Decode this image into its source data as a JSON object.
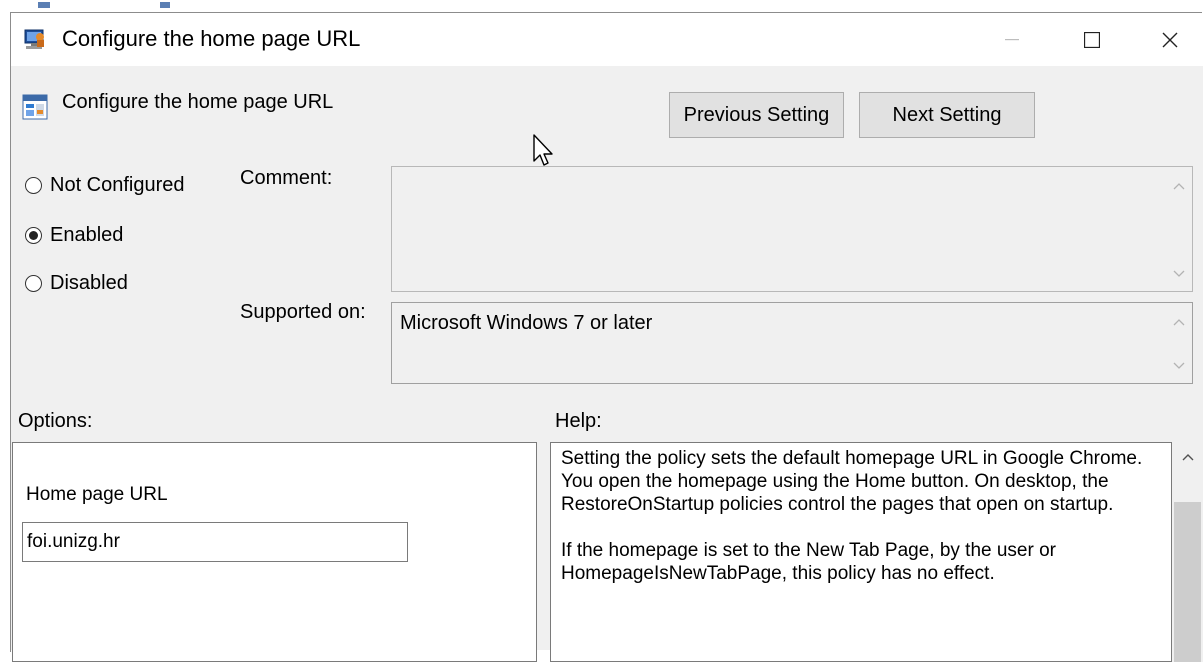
{
  "window": {
    "title": "Configure the home page URL",
    "controls": {
      "minimize": "—",
      "maximize": "☐",
      "close": "✕"
    }
  },
  "header": {
    "setting_name": "Configure the home page URL",
    "previous_label": "Previous Setting",
    "next_label": "Next Setting"
  },
  "state": {
    "options": [
      {
        "label": "Not Configured",
        "selected": false
      },
      {
        "label": "Enabled",
        "selected": true
      },
      {
        "label": "Disabled",
        "selected": false
      }
    ]
  },
  "comment": {
    "label": "Comment:",
    "value": ""
  },
  "supported": {
    "label": "Supported on:",
    "value": "Microsoft Windows 7 or later"
  },
  "options_panel": {
    "label": "Options:",
    "field_label": "Home page URL",
    "field_value": "foi.unizg.hr"
  },
  "help_panel": {
    "label": "Help:",
    "paragraphs": [
      "Setting the policy sets the default homepage URL in Google Chrome. You open the homepage using the Home button. On desktop, the RestoreOnStartup policies control the pages that open on startup.",
      "If the homepage is set to the New Tab Page, by the user or HomepageIsNewTabPage, this policy has no effect."
    ]
  },
  "icons": {
    "app": "group-policy-icon",
    "setting": "policy-setting-icon",
    "cursor": "mouse-pointer-icon"
  },
  "colors": {
    "client_bg": "#f0f0f0",
    "button_bg": "#e1e1e1",
    "border": "#adadad"
  }
}
